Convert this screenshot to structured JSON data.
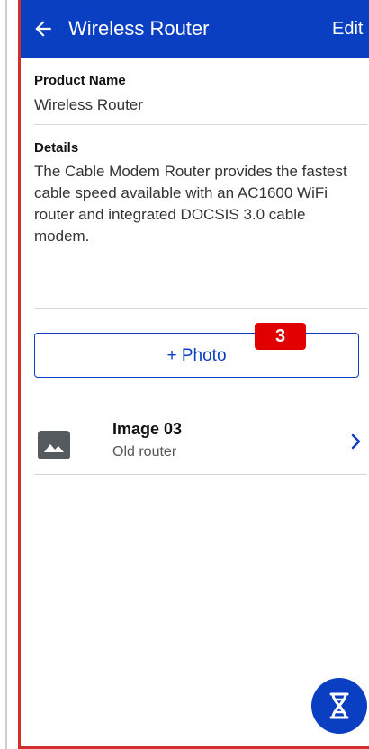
{
  "header": {
    "title": "Wireless Router",
    "edit_label": "Edit",
    "back_icon": "arrow-left-icon"
  },
  "fields": {
    "product_name_label": "Product Name",
    "product_name_value": "Wireless Router",
    "details_label": "Details",
    "details_value": "The Cable Modem Router provides the fastest cable speed available with an AC1600 WiFi router and integrated DOCSIS 3.0 cable modem."
  },
  "photo_button": {
    "label": "+ Photo"
  },
  "badge": {
    "text": "3"
  },
  "images": [
    {
      "title": "Image 03",
      "subtitle": "Old router",
      "icon": "image-placeholder-icon"
    }
  ],
  "fab": {
    "icon": "dna-icon"
  },
  "colors": {
    "primary": "#0b3fc2",
    "badge": "#e00000",
    "frame_border": "#d32f2f"
  }
}
